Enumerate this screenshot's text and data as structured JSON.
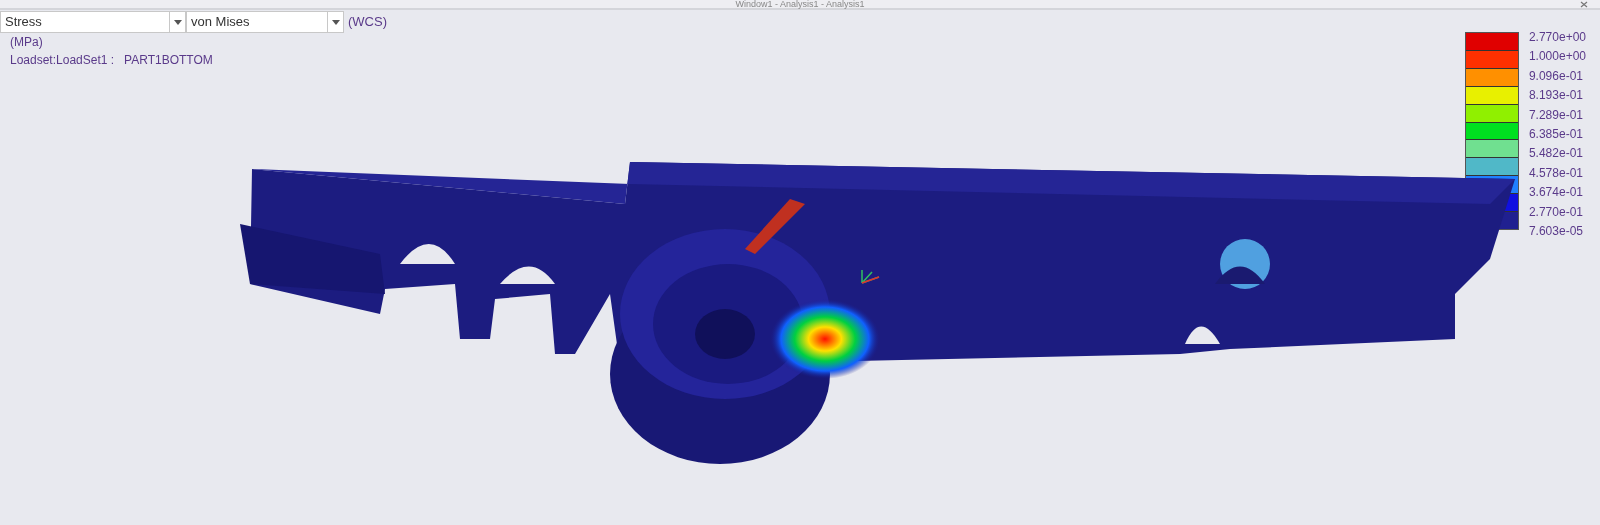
{
  "window": {
    "title": "Window1  - Analysis1 - Analysis1"
  },
  "toolbar": {
    "quantity": "Stress",
    "component": "von Mises",
    "system": "(WCS)"
  },
  "info": {
    "units": "(MPa)",
    "loadset": "Loadset:LoadSet1 :   PART1BOTTOM"
  },
  "legend": {
    "labels": [
      "2.770e+00",
      "1.000e+00",
      "9.096e-01",
      "8.193e-01",
      "7.289e-01",
      "6.385e-01",
      "5.482e-01",
      "4.578e-01",
      "3.674e-01",
      "2.770e-01",
      "7.603e-05"
    ],
    "bands": [
      {
        "color": "#e00000"
      },
      {
        "color": "#ff3000"
      },
      {
        "color": "#ff9000"
      },
      {
        "color": "#e8f000"
      },
      {
        "color": "#90f000"
      },
      {
        "color": "#00e020"
      },
      {
        "color": "#70e090"
      },
      {
        "color": "#50b8c8"
      },
      {
        "color": "#2080ff"
      },
      {
        "color": "#1010e0"
      },
      {
        "color": "#202090"
      }
    ]
  }
}
